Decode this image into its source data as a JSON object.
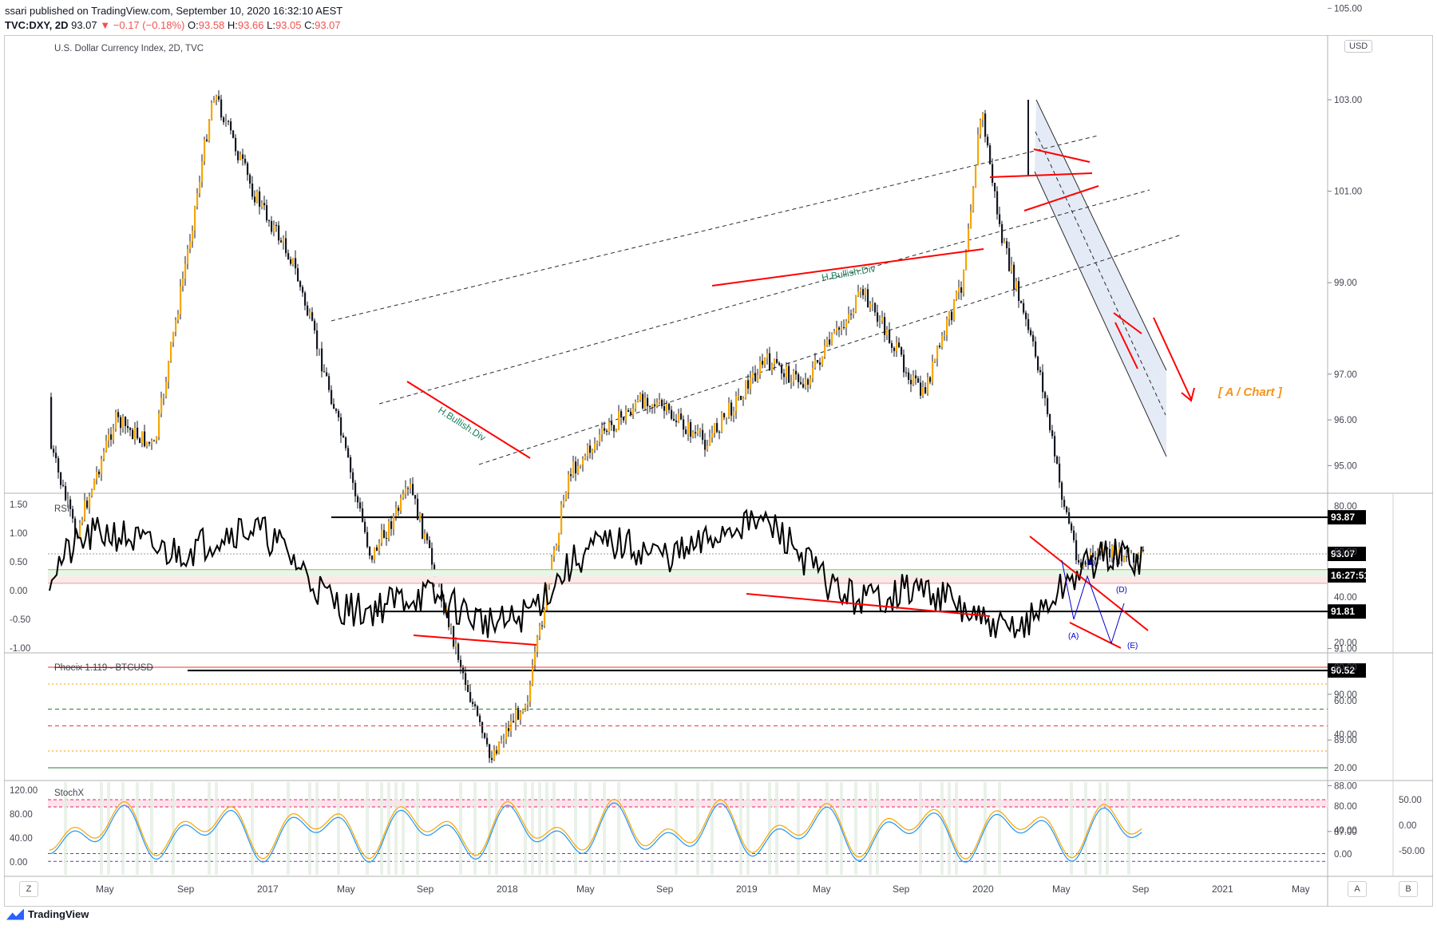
{
  "header": {
    "publisher": "ssari published on TradingView.com, September 10, 2020 16:32:10 AEST",
    "symbol": "TVC:DXY, 2D",
    "last": "93.07",
    "change": "−0.17 (−0.18%)",
    "open_label": "O:",
    "open": "93.58",
    "high_label": "H:",
    "high": "93.66",
    "low_label": "L:",
    "low": "93.05",
    "close_label": "C:",
    "close": "93.07"
  },
  "main_pane": {
    "title": "U.S. Dollar Currency Index, 2D, TVC",
    "currency_button": "USD",
    "price_ticks": [
      "105.00",
      "103.00",
      "101.00",
      "99.00",
      "97.00",
      "96.00",
      "95.00",
      "93.87",
      "93.07",
      "91.81",
      "91.00",
      "90.52",
      "90.00",
      "89.00",
      "88.00",
      "87.00"
    ],
    "price_labels": [
      {
        "text": "93.87",
        "value": 93.87
      },
      {
        "text": "93.07",
        "value": 93.07
      },
      {
        "text": "16:27:51",
        "value": 92.6
      },
      {
        "text": "91.81",
        "value": 91.81
      },
      {
        "text": "90.52",
        "value": 90.52
      }
    ],
    "annotations": {
      "chart_tag": "[ A / Chart ]",
      "div1": "H.Bullish.Div",
      "div2": "H.Bullish.Div"
    }
  },
  "rsi_pane": {
    "title": "RSI",
    "left_ticks": [
      "1.50",
      "1.00",
      "0.50",
      "0.00",
      "-0.50",
      "-1.00"
    ],
    "right_ticks": [
      "80.00",
      "60.00",
      "40.00",
      "20.00"
    ],
    "wave_labels": [
      "(A)",
      "(B)",
      "(D)",
      "(E)"
    ]
  },
  "phoeix_pane": {
    "title": "Phoeix 1.119 - BTCUSD",
    "right_ticks": [
      "80.00",
      "60.00",
      "40.00",
      "20.00"
    ]
  },
  "stoch_pane": {
    "title": "StochX",
    "left_ticks": [
      "120.00",
      "80.00",
      "40.00",
      "0.00"
    ],
    "right_ticks_a": [
      "80.00",
      "40.00",
      "0.00"
    ],
    "right_ticks_b": [
      "50.00",
      "0.00",
      "-50.00"
    ]
  },
  "time_axis": [
    "May",
    "Sep",
    "2017",
    "May",
    "Sep",
    "2018",
    "May",
    "Sep",
    "2019",
    "May",
    "Sep",
    "2020",
    "May",
    "Sep",
    "2021",
    "May"
  ],
  "footer": {
    "logo_text": "TradingView",
    "btn_z": "Z",
    "btn_a": "A",
    "btn_b": "B"
  },
  "colors": {
    "up": "#f7a600",
    "down": "#131722",
    "red": "#ff0000",
    "navy": "#0000cc",
    "channel": "#2b2b2b",
    "band": "#dbe4f3"
  },
  "chart_data": {
    "type": "candlestick",
    "title": "U.S. Dollar Currency Index, 2D, TVC",
    "x_range": [
      "2016-03",
      "2021-07"
    ],
    "y_range": [
      87,
      105.5
    ],
    "key_levels": [
      93.87,
      91.81,
      90.52
    ],
    "last_price": 93.07,
    "approx_path": [
      {
        "date": "2016-03",
        "close": 96.5
      },
      {
        "date": "2016-05",
        "close": 93.5
      },
      {
        "date": "2016-07",
        "close": 96.0
      },
      {
        "date": "2016-09",
        "close": 95.4
      },
      {
        "date": "2016-11",
        "close": 100.5
      },
      {
        "date": "2016-12",
        "close": 103.2
      },
      {
        "date": "2017-02",
        "close": 101.0
      },
      {
        "date": "2017-04",
        "close": 99.5
      },
      {
        "date": "2017-06",
        "close": 96.5
      },
      {
        "date": "2017-08",
        "close": 93.0
      },
      {
        "date": "2017-10",
        "close": 94.5
      },
      {
        "date": "2018-01",
        "close": 90.0
      },
      {
        "date": "2018-02",
        "close": 88.6
      },
      {
        "date": "2018-04",
        "close": 90.0
      },
      {
        "date": "2018-06",
        "close": 94.8
      },
      {
        "date": "2018-08",
        "close": 95.8
      },
      {
        "date": "2018-10",
        "close": 96.5
      },
      {
        "date": "2019-01",
        "close": 95.5
      },
      {
        "date": "2019-04",
        "close": 97.3
      },
      {
        "date": "2019-06",
        "close": 96.8
      },
      {
        "date": "2019-09",
        "close": 98.8
      },
      {
        "date": "2019-12",
        "close": 96.5
      },
      {
        "date": "2020-02",
        "close": 99.0
      },
      {
        "date": "2020-03",
        "close": 102.8
      },
      {
        "date": "2020-04",
        "close": 100.0
      },
      {
        "date": "2020-06",
        "close": 97.0
      },
      {
        "date": "2020-07",
        "close": 94.5
      },
      {
        "date": "2020-08",
        "close": 92.8
      },
      {
        "date": "2020-09",
        "close": 93.07
      }
    ]
  }
}
